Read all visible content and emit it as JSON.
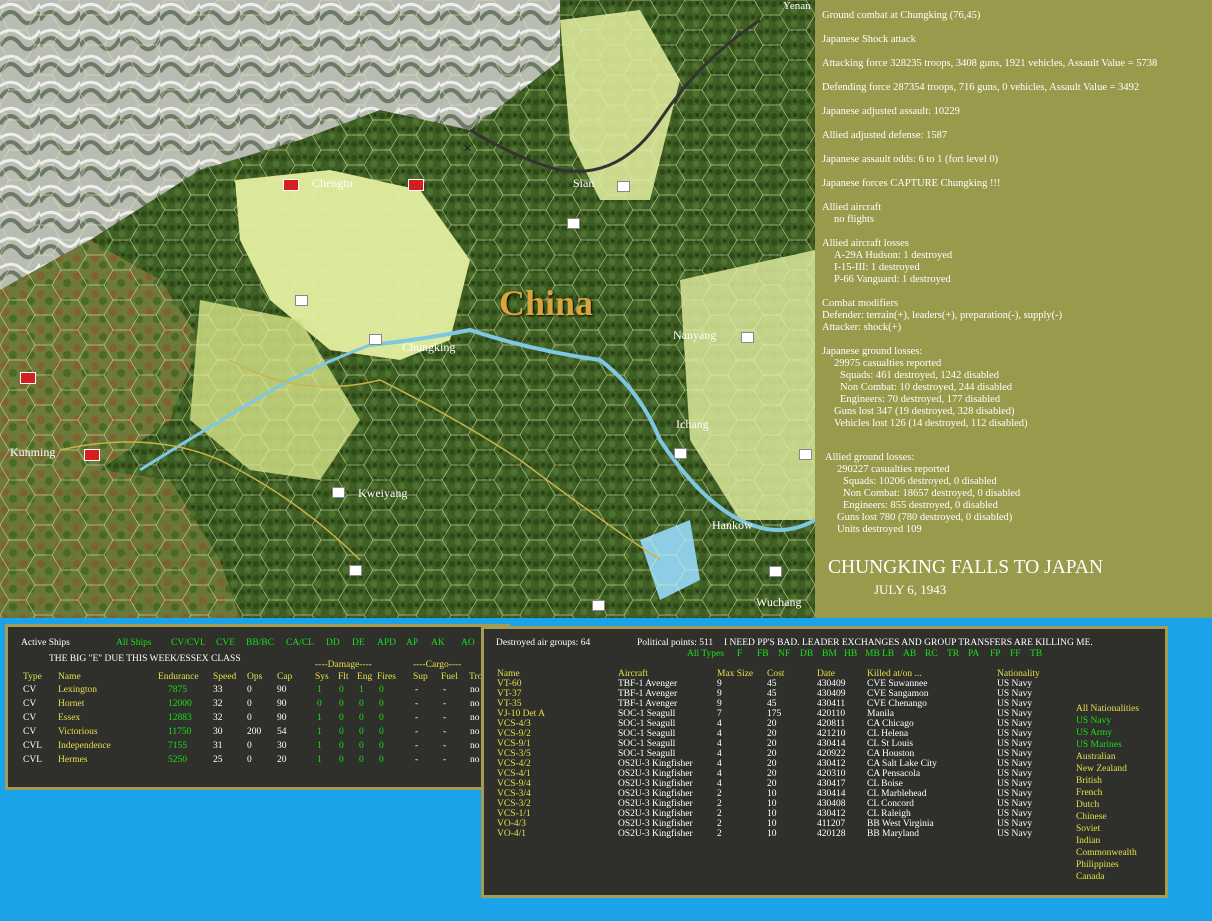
{
  "map": {
    "labels": [
      {
        "name": "chengtu",
        "text": "Chengtu"
      },
      {
        "name": "sian",
        "text": "Sian"
      },
      {
        "name": "china",
        "text": "China"
      },
      {
        "name": "chungking",
        "text": "Chungking"
      },
      {
        "name": "nanyang",
        "text": "Nanyang"
      },
      {
        "name": "ichang",
        "text": "Ichang"
      },
      {
        "name": "kunming",
        "text": "Kunming"
      },
      {
        "name": "kweiyang",
        "text": "Kweiyang"
      },
      {
        "name": "hankow",
        "text": "Hankow"
      },
      {
        "name": "wuchang",
        "text": "Wuchang"
      },
      {
        "name": "yenan",
        "text": "Yenan"
      }
    ]
  },
  "report": {
    "lines": [
      "Ground combat at Chungking (76,45)",
      "Japanese Shock attack",
      "Attacking force 328235 troops, 3408 guns, 1921 vehicles, Assault Value = 5738",
      "Defending force 287354 troops, 716 guns, 0 vehicles, Assault Value = 3492",
      "Japanese adjusted assault: 10229",
      "Allied adjusted defense: 1587",
      "Japanese assault odds: 6 to 1 (fort level 0)",
      "Japanese forces CAPTURE Chungking !!!",
      "Allied aircraft",
      "no flights",
      "Allied aircraft losses",
      "A-29A Hudson: 1 destroyed",
      "I-15-III: 1 destroyed",
      "P-66 Vanguard: 1 destroyed",
      "Combat modifiers",
      "Defender: terrain(+), leaders(+), preparation(-), supply(-)",
      "Attacker: shock(+)",
      "Japanese ground losses:",
      "29975 casualties reported",
      "Squads: 461 destroyed, 1242 disabled",
      "Non Combat: 10 destroyed, 244 disabled",
      "Engineers: 70 destroyed, 177 disabled",
      "Guns lost 347 (19 destroyed, 328 disabled)",
      "Vehicles lost 126 (14 destroyed, 112 disabled)",
      "Allied ground losses:",
      "290227 casualties reported",
      "Squads: 10206 destroyed, 0 disabled",
      "Non Combat: 18657 destroyed, 0 disabled",
      "Engineers: 855 destroyed, 0 disabled",
      "Guns lost 780 (780 destroyed, 0 disabled)",
      "Units destroyed 109"
    ],
    "headline": "CHUNGKING FALLS TO JAPAN",
    "date": "JULY 6, 1943"
  },
  "ships": {
    "title": "Active Ships",
    "filters": [
      "All Ships",
      "CV/CVL",
      "CVE",
      "BB/BC",
      "CA/CL",
      "DD",
      "DE",
      "APD",
      "AP",
      "AK",
      "AO"
    ],
    "subtitle": "THE BIG \"E\" DUE THIS WEEK/ESSEX CLASS",
    "damage_header": "----Damage----",
    "cargo_header": "----Cargo----",
    "columns": [
      "Type",
      "Name",
      "Endurance",
      "Speed",
      "Ops",
      "Cap",
      "Sys",
      "Flt",
      "Eng",
      "Fires",
      "Sup",
      "Fuel",
      "Tro"
    ],
    "rows": [
      [
        "CV",
        "Lexington",
        "7875",
        "33",
        "0",
        "90",
        "1",
        "0",
        "1",
        "0",
        "-",
        "-",
        "no"
      ],
      [
        "CV",
        "Hornet",
        "12000",
        "32",
        "0",
        "90",
        "0",
        "0",
        "0",
        "0",
        "-",
        "-",
        "no"
      ],
      [
        "CV",
        "Essex",
        "12883",
        "32",
        "0",
        "90",
        "1",
        "0",
        "0",
        "0",
        "-",
        "-",
        "no"
      ],
      [
        "CV",
        "Victorious",
        "11750",
        "30",
        "200",
        "54",
        "1",
        "0",
        "0",
        "0",
        "-",
        "-",
        "no"
      ],
      [
        "CVL",
        "Independence",
        "7155",
        "31",
        "0",
        "30",
        "1",
        "0",
        "0",
        "0",
        "-",
        "-",
        "no"
      ],
      [
        "CVL",
        "Hermes",
        "5250",
        "25",
        "0",
        "20",
        "1",
        "0",
        "0",
        "0",
        "-",
        "-",
        "no"
      ]
    ]
  },
  "air": {
    "destroyed": "Destroyed air groups: 64",
    "political": "Political points: 511",
    "comment": "I NEED PP'S BAD. LEADER EXCHANGES AND GROUP TRANSFERS ARE KILLING ME.",
    "type_filters": [
      "All Types",
      "F",
      "FB",
      "NF",
      "DB",
      "BM",
      "HB",
      "MB",
      "LB",
      "AB",
      "RC",
      "TR",
      "PA",
      "FP",
      "FF",
      "TB"
    ],
    "columns": [
      "Name",
      "Aircraft",
      "Max Size",
      "Cost",
      "Date",
      "Killed at/on ...",
      "Nationality"
    ],
    "rows": [
      [
        "VT-60",
        "TBF-1 Avenger",
        "9",
        "45",
        "430409",
        "CVE Suwannee",
        "US Navy"
      ],
      [
        "VT-37",
        "TBF-1 Avenger",
        "9",
        "45",
        "430409",
        "CVE Sangamon",
        "US Navy"
      ],
      [
        "VT-35",
        "TBF-1 Avenger",
        "9",
        "45",
        "430411",
        "CVE Chenango",
        "US Navy"
      ],
      [
        "VJ-10 Det A",
        "SOC-1 Seagull",
        "7",
        "175",
        "420110",
        "Manila",
        "US Navy"
      ],
      [
        "VCS-4/3",
        "SOC-1 Seagull",
        "4",
        "20",
        "420811",
        "CA Chicago",
        "US Navy"
      ],
      [
        "VCS-9/2",
        "SOC-1 Seagull",
        "4",
        "20",
        "421210",
        "CL Helena",
        "US Navy"
      ],
      [
        "VCS-9/1",
        "SOC-1 Seagull",
        "4",
        "20",
        "430414",
        "CL St Louis",
        "US Navy"
      ],
      [
        "VCS-3/5",
        "SOC-1 Seagull",
        "4",
        "20",
        "420922",
        "CA Houston",
        "US Navy"
      ],
      [
        "VCS-4/2",
        "OS2U-3 Kingfisher",
        "4",
        "20",
        "430412",
        "CA Salt Lake City",
        "US Navy"
      ],
      [
        "VCS-4/1",
        "OS2U-3 Kingfisher",
        "4",
        "20",
        "420310",
        "CA Pensacola",
        "US Navy"
      ],
      [
        "VCS-9/4",
        "OS2U-3 Kingfisher",
        "4",
        "20",
        "430417",
        "CL Boise",
        "US Navy"
      ],
      [
        "VCS-3/4",
        "OS2U-3 Kingfisher",
        "2",
        "10",
        "430414",
        "CL Marblehead",
        "US Navy"
      ],
      [
        "VCS-3/2",
        "OS2U-3 Kingfisher",
        "2",
        "10",
        "430408",
        "CL Concord",
        "US Navy"
      ],
      [
        "VCS-1/1",
        "OS2U-3 Kingfisher",
        "2",
        "10",
        "430412",
        "CL Raleigh",
        "US Navy"
      ],
      [
        "VO-4/3",
        "OS2U-3 Kingfisher",
        "2",
        "10",
        "411207",
        "BB West Virginia",
        "US Navy"
      ],
      [
        "VO-4/1",
        "OS2U-3 Kingfisher",
        "2",
        "10",
        "420128",
        "BB Maryland",
        "US Navy"
      ]
    ],
    "nationalities": [
      "All Nationalities",
      "US Navy",
      "US Army",
      "US Marines",
      "Australian",
      "New Zealand",
      "British",
      "French",
      "Dutch",
      "Chinese",
      "Soviet",
      "Indian",
      "Commonwealth",
      "Philippines",
      "Canada"
    ]
  }
}
